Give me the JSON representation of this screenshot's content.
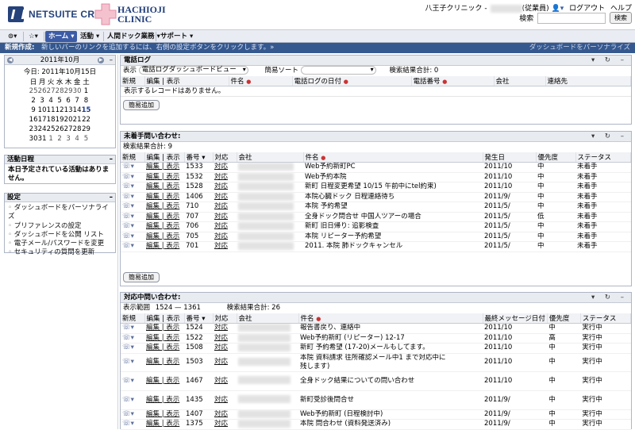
{
  "header": {
    "logo_text": "NETSUITE CRM+",
    "partner_logo_line1": "HACHIOJI",
    "partner_logo_line2": "CLINIC",
    "clinic": "八王子クリニック -",
    "user_suffix": "(従業員)",
    "logout": "ログアウト",
    "help": "ヘルプ",
    "search_label": "検索",
    "search_button": "検索",
    "search_value": ""
  },
  "nav": {
    "items": [
      "ホーム",
      "活動",
      "人間ドック業務",
      "サポート"
    ]
  },
  "news": {
    "title": "新規作成:",
    "text": "新しいバーのリンクを追加するには、右側の設定ボタンをクリックします。»",
    "personalize": "ダッシュボードをパーソナライズ"
  },
  "calendar": {
    "month": "2011年10月",
    "today": "今日: 2011年10月15日",
    "weekdays": [
      "日",
      "月",
      "火",
      "水",
      "木",
      "金",
      "土"
    ],
    "weeks": [
      [
        "25",
        "26",
        "27",
        "28",
        "29",
        "30",
        "1"
      ],
      [
        "2",
        "3",
        "4",
        "5",
        "6",
        "7",
        "8"
      ],
      [
        "9",
        "10",
        "11",
        "12",
        "13",
        "14",
        "15"
      ],
      [
        "16",
        "17",
        "18",
        "19",
        "20",
        "21",
        "22"
      ],
      [
        "23",
        "24",
        "25",
        "26",
        "27",
        "28",
        "29"
      ],
      [
        "30",
        "31",
        "1",
        "2",
        "3",
        "4",
        "5"
      ]
    ]
  },
  "schedule": {
    "title": "活動日程",
    "text": "本日予定されている活動はありません。"
  },
  "settings": {
    "title": "設定",
    "items": [
      "ダッシュボードをパーソナライズ",
      "プリファレンスの設定",
      "ダッシュボードを公開 リスト",
      "電子メール/パスワードを変更",
      "セキュリティの質問を更新"
    ]
  },
  "phone_log": {
    "title": "電話ログ",
    "display_label": "表示",
    "display_value": "電話ログダッシュボードビュー",
    "sort_label": "簡易ソート",
    "total": "検索結果合計: 0",
    "columns": [
      "新規",
      "編集 | 表示",
      "件名",
      "電話ログの日付",
      "電話番号",
      "会社",
      "連絡先"
    ],
    "empty": "表示するレコードはありません。",
    "add": "簡易追加"
  },
  "unassigned": {
    "title": "未着手問い合わせ:",
    "total": "検索結果合計: 9",
    "columns": [
      "新規",
      "編集 | 表示",
      "番号",
      "対応",
      "会社",
      "件名",
      "発生日",
      "優先度",
      "ステータス"
    ],
    "rows": [
      {
        "no": "1533",
        "act": "対応",
        "subj": "Web予約新町PC",
        "date": "2011/10",
        "pri": "中",
        "st": "未着手"
      },
      {
        "no": "1532",
        "act": "対応",
        "subj": "Web予約本院",
        "date": "2011/10",
        "pri": "中",
        "st": "未着手"
      },
      {
        "no": "1528",
        "act": "対応",
        "subj": "新町  日程変更希望              10/15  午前中にtel約束)",
        "date": "2011/10",
        "pri": "中",
        "st": "未着手"
      },
      {
        "no": "1406",
        "act": "対応",
        "subj": "本院心臓ドック  日程連絡待ち",
        "date": "2011/9/",
        "pri": "中",
        "st": "未着手"
      },
      {
        "no": "710",
        "act": "対応",
        "subj": "本院  予約希望",
        "date": "2011/5/",
        "pri": "中",
        "st": "未着手"
      },
      {
        "no": "707",
        "act": "対応",
        "subj": "全身ドック問合せ  中国人ツアーの場合",
        "date": "2011/5/",
        "pri": "低",
        "st": "未着手"
      },
      {
        "no": "706",
        "act": "対応",
        "subj": "新町  旧日帰り: 追影検査",
        "date": "2011/5/",
        "pri": "中",
        "st": "未着手"
      },
      {
        "no": "705",
        "act": "対応",
        "subj": "本院  リピーター予約希望",
        "date": "2011/5/",
        "pri": "中",
        "st": "未着手"
      },
      {
        "no": "701",
        "act": "対応",
        "subj": "2011.        本院  肺ドックキャンセル",
        "date": "2011/5/",
        "pri": "中",
        "st": "未着手"
      }
    ],
    "add": "簡易追加"
  },
  "in_progress": {
    "title": "対応中問い合わせ:",
    "range_label": "表示範囲",
    "range_value": "1524 — 1361",
    "total": "検索結果合計: 26",
    "columns": [
      "新規",
      "編集 | 表示",
      "番号",
      "対応",
      "会社",
      "件名",
      "最終メッセージ日付",
      "優先度",
      "ステータス"
    ],
    "rows": [
      {
        "no": "1524",
        "act": "対応",
        "subj": "報告書戻り、連絡中",
        "date": "2011/10",
        "pri": "中",
        "st": "実行中"
      },
      {
        "no": "1522",
        "act": "対応",
        "subj": "Web予約新町              (リピーター) 12-17",
        "date": "2011/10",
        "pri": "高",
        "st": "実行中"
      },
      {
        "no": "1508",
        "act": "対応",
        "subj": "新町  予約希望            (17-20)メールもしてます。",
        "date": "2011/10",
        "pri": "中",
        "st": "実行中"
      },
      {
        "no": "1503",
        "act": "対応",
        "subj": "本院  資料請求          往所確認メール中1         まで対応中に",
        "date": "2011/10",
        "pri": "中",
        "st": "実行中"
      },
      {
        "no": "1467",
        "act": "対応",
        "subj": "全身ドック結果についての問い合わせ",
        "date": "2011/10",
        "pri": "中",
        "st": "実行中"
      },
      {
        "no": "1435",
        "act": "対応",
        "subj": "新町受診後問合せ",
        "date": "2011/9/",
        "pri": "中",
        "st": "実行中"
      },
      {
        "no": "1407",
        "act": "対応",
        "subj": "Web予約新町              (日程検討中)",
        "date": "2011/9/",
        "pri": "中",
        "st": "実行中"
      },
      {
        "no": "1375",
        "act": "対応",
        "subj": "本院  問合わせ         (資料発送済み)",
        "date": "2011/9/",
        "pri": "中",
        "st": "実行中"
      }
    ],
    "row_4_extra": "残します)"
  }
}
